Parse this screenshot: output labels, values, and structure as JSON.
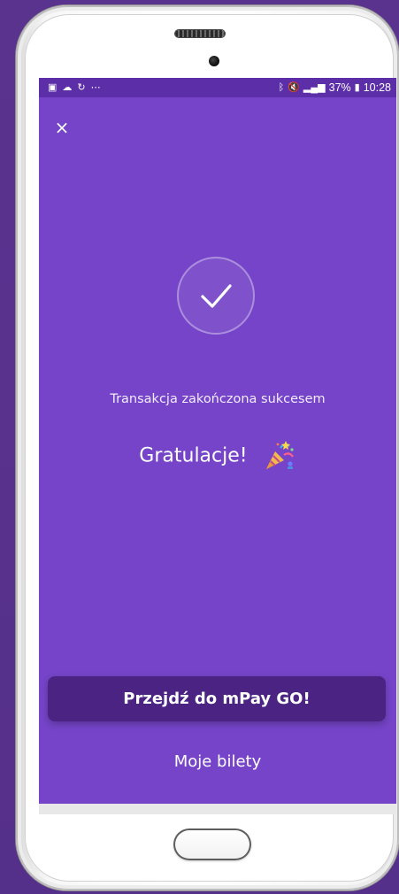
{
  "status_bar": {
    "left_icons": [
      "image-icon",
      "cloud-icon",
      "sync-icon",
      "more-icon"
    ],
    "right_icons": [
      "bluetooth-icon",
      "mute-icon",
      "lte-signal-icon"
    ],
    "battery": "37%",
    "time": "10:28"
  },
  "close_label": "×",
  "message": {
    "subtitle": "Transakcja zakończona sukcesem",
    "title": "Gratulacje!"
  },
  "actions": {
    "primary": "Przejdź do mPay GO!",
    "secondary": "Moje bilety"
  },
  "colors": {
    "screen_bg": "#7544c8",
    "status_bar_bg": "#5c2fa8",
    "primary_button_bg": "#4b2383",
    "page_bg": "#55318a"
  }
}
